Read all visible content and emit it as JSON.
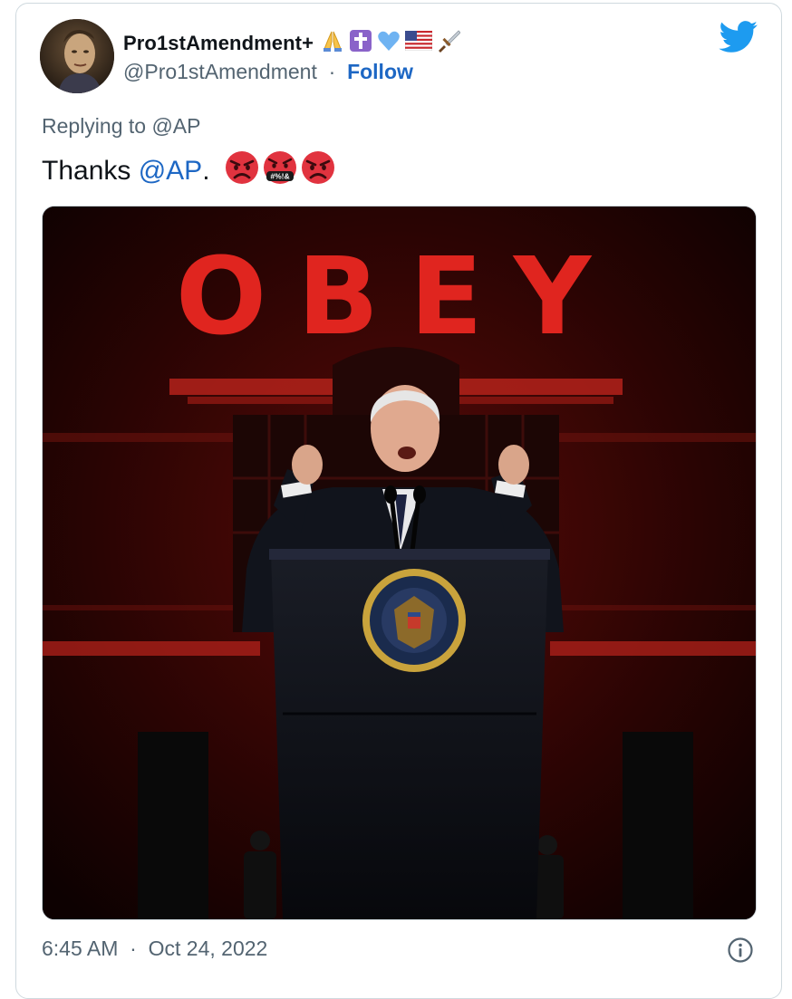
{
  "author": {
    "display_name": "Pro1stAmendment+",
    "handle": "@Pro1stAmendment",
    "separator": "·",
    "follow_label": "Follow",
    "name_emojis": [
      "folded-hands-icon",
      "latin-cross-icon",
      "blue-heart-icon",
      "us-flag-icon",
      "dagger-icon"
    ]
  },
  "tweet": {
    "replying_to": "Replying to @AP",
    "text_prefix": "Thanks ",
    "mention": "@AP",
    "text_suffix": ".",
    "emojis": [
      "angry-face-icon",
      "face-with-symbols-icon",
      "angry-face-icon"
    ],
    "symbols_text": "#%!&"
  },
  "media": {
    "sign_text": "OBEY"
  },
  "footer": {
    "time": "6:45 AM",
    "separator": "·",
    "date": "Oct 24, 2022"
  },
  "colors": {
    "link": "#1d67c4",
    "twitter_blue": "#1d9bf0",
    "muted": "#536471",
    "sign_red": "#e0251f",
    "angry_red": "#e1333f"
  }
}
